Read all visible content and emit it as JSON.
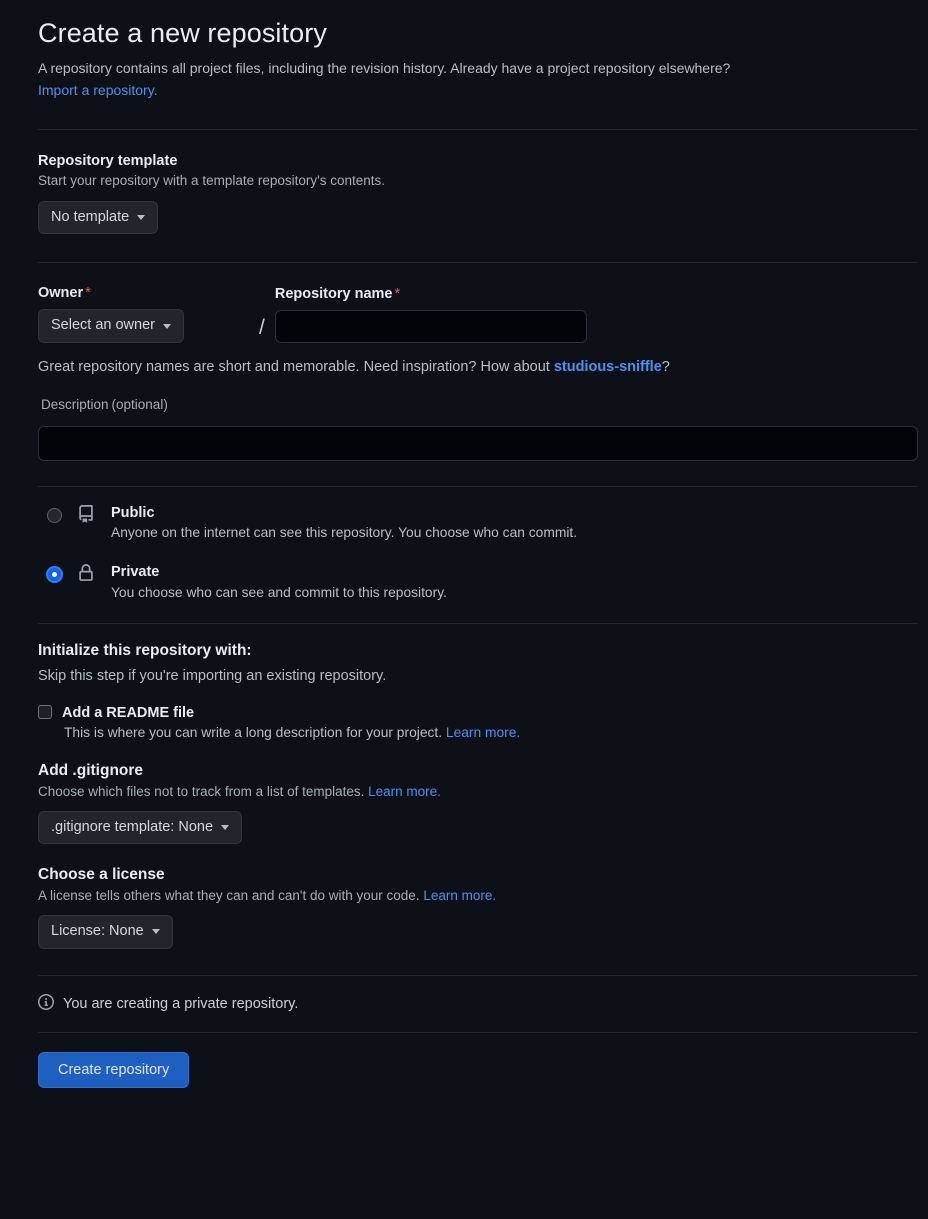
{
  "header": {
    "title": "Create a new repository",
    "description": "A repository contains all project files, including the revision history. Already have a project repository elsewhere?",
    "import_link": "Import a repository."
  },
  "template_section": {
    "heading": "Repository template",
    "description": "Start your repository with a template repository's contents.",
    "dropdown_value": "No template"
  },
  "owner_section": {
    "owner_label": "Owner",
    "owner_required": "*",
    "owner_dropdown_value": "Select an owner",
    "separator": "/",
    "repo_name_label": "Repository name",
    "repo_name_required": "*",
    "repo_name_value": "",
    "repo_name_placeholder": "",
    "hint_prefix": "Great repository names are short and memorable. Need inspiration? How about ",
    "hint_suggestion": "studious-sniffle",
    "hint_suffix": "?"
  },
  "description_section": {
    "label": "Description",
    "optional": "(optional)",
    "value": "",
    "placeholder": ""
  },
  "visibility": {
    "options": [
      {
        "name": "Public",
        "description": "Anyone on the internet can see this repository. You choose who can commit.",
        "icon": "repo-icon",
        "selected": false
      },
      {
        "name": "Private",
        "description": "You choose who can see and commit to this repository.",
        "icon": "lock-icon",
        "selected": true
      }
    ]
  },
  "initialize": {
    "heading": "Initialize this repository with:",
    "subheading": "Skip this step if you're importing an existing repository.",
    "readme_label": "Add a README file",
    "readme_checked": false,
    "readme_description": "This is where you can write a long description for your project. ",
    "readme_learn_more": "Learn more."
  },
  "gitignore": {
    "heading": "Add .gitignore",
    "description": "Choose which files not to track from a list of templates. ",
    "learn_more": "Learn more.",
    "dropdown_value": ".gitignore template: None"
  },
  "license": {
    "heading": "Choose a license",
    "description": "A license tells others what they can and can't do with your code. ",
    "learn_more": "Learn more.",
    "dropdown_value": "License: None"
  },
  "footer": {
    "notice_icon": "info-icon",
    "notice": "You are creating a private repository.",
    "submit_label": "Create repository"
  },
  "colors": {
    "background": "#0d1117",
    "input_background": "#010409",
    "button_background": "#21262d",
    "primary_button": "#1f5fc0",
    "link": "#4a92f0",
    "required_asterisk": "#f85149",
    "radio_selected": "#0d63e5",
    "border": "#30363d"
  }
}
